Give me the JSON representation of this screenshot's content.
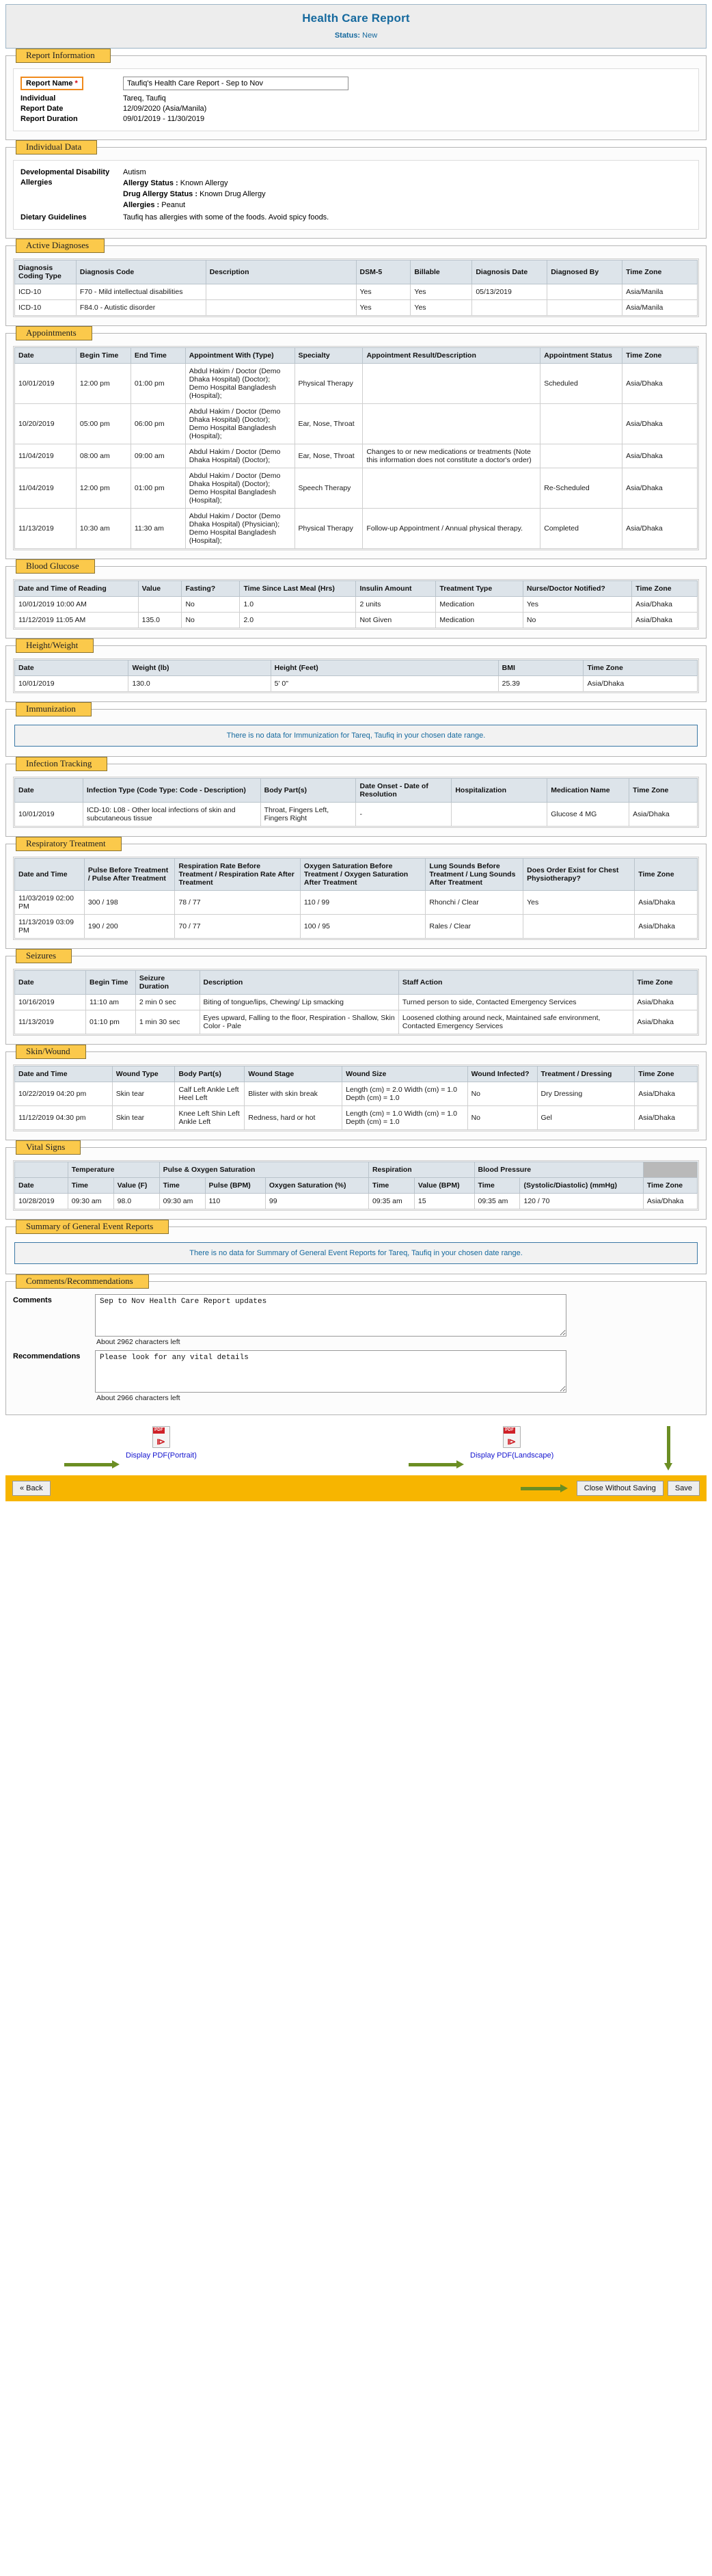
{
  "header": {
    "title": "Health Care Report",
    "status_label": "Status:",
    "status_value": "New"
  },
  "report_information": {
    "legend": "Report Information",
    "report_name_label": "Report Name",
    "required_mark": "*",
    "report_name_value": "Taufiq's Health Care Report - Sep to Nov",
    "individual_label": "Individual",
    "individual_value": "Tareq, Taufiq",
    "report_date_label": "Report Date",
    "report_date_value": "12/09/2020  (Asia/Manila)",
    "report_duration_label": "Report Duration",
    "report_duration_value": "09/01/2019 - 11/30/2019"
  },
  "individual_data": {
    "legend": "Individual Data",
    "dd_label": "Developmental Disability",
    "dd_value": "Autism",
    "allergies_label": "Allergies",
    "allergy_status_label": "Allergy Status :",
    "allergy_status_value": "Known Allergy",
    "drug_allergy_status_label": "Drug Allergy Status :",
    "drug_allergy_status_value": "Known Drug Allergy",
    "allergies_list_label": "Allergies :",
    "allergies_list_value": "Peanut",
    "dietary_label": "Dietary Guidelines",
    "dietary_value": "Taufiq has allergies with some of the foods. Avoid spicy foods."
  },
  "active_diagnoses": {
    "legend": "Active Diagnoses",
    "columns": [
      "Diagnosis Coding Type",
      "Diagnosis Code",
      "Description",
      "DSM-5",
      "Billable",
      "Diagnosis Date",
      "Diagnosed By",
      "Time Zone"
    ],
    "rows": [
      [
        "ICD-10",
        "F70 - Mild intellectual disabilities",
        "",
        "Yes",
        "Yes",
        "05/13/2019",
        "",
        "Asia/Manila"
      ],
      [
        "ICD-10",
        "F84.0 - Autistic disorder",
        "",
        "Yes",
        "Yes",
        "",
        "",
        "Asia/Manila"
      ]
    ]
  },
  "appointments": {
    "legend": "Appointments",
    "columns": [
      "Date",
      "Begin Time",
      "End Time",
      "Appointment With (Type)",
      "Specialty",
      "Appointment Result/Description",
      "Appointment Status",
      "Time Zone"
    ],
    "rows": [
      [
        "10/01/2019",
        "12:00 pm",
        "01:00 pm",
        "Abdul Hakim / Doctor (Demo Dhaka Hospital) (Doctor); Demo Hospital Bangladesh (Hospital);",
        "Physical Therapy",
        "",
        "Scheduled",
        "Asia/Dhaka"
      ],
      [
        "10/20/2019",
        "05:00 pm",
        "06:00 pm",
        "Abdul Hakim / Doctor (Demo Dhaka Hospital) (Doctor); Demo Hospital Bangladesh (Hospital);",
        "Ear, Nose, Throat",
        "",
        "",
        "Asia/Dhaka"
      ],
      [
        "11/04/2019",
        "08:00 am",
        "09:00 am",
        "Abdul Hakim / Doctor (Demo Dhaka Hospital) (Doctor);",
        "Ear, Nose, Throat",
        "Changes to or new medications or treatments (Note this information does not constitute a doctor's order)",
        "",
        "Asia/Dhaka"
      ],
      [
        "11/04/2019",
        "12:00 pm",
        "01:00 pm",
        "Abdul Hakim / Doctor (Demo Dhaka Hospital) (Doctor); Demo Hospital Bangladesh (Hospital);",
        "Speech Therapy",
        "",
        "Re-Scheduled",
        "Asia/Dhaka"
      ],
      [
        "11/13/2019",
        "10:30 am",
        "11:30 am",
        "Abdul Hakim / Doctor (Demo Dhaka Hospital) (Physician); Demo Hospital Bangladesh (Hospital);",
        "Physical Therapy",
        "Follow-up Appointment / Annual physical therapy.",
        "Completed",
        "Asia/Dhaka"
      ]
    ]
  },
  "blood_glucose": {
    "legend": "Blood Glucose",
    "columns": [
      "Date and Time of Reading",
      "Value",
      "Fasting?",
      "Time Since Last Meal (Hrs)",
      "Insulin Amount",
      "Treatment Type",
      "Nurse/Doctor Notified?",
      "Time Zone"
    ],
    "rows": [
      [
        "10/01/2019 10:00 AM",
        "",
        "No",
        "1.0",
        "2 units",
        "Medication",
        "Yes",
        "Asia/Dhaka"
      ],
      [
        "11/12/2019 11:05 AM",
        "135.0",
        "No",
        "2.0",
        "Not Given",
        "Medication",
        "No",
        "Asia/Dhaka"
      ]
    ]
  },
  "height_weight": {
    "legend": "Height/Weight",
    "columns": [
      "Date",
      "Weight (lb)",
      "Height (Feet)",
      "BMI",
      "Time Zone"
    ],
    "rows": [
      [
        "10/01/2019",
        "130.0",
        "5' 0\"",
        "25.39",
        "Asia/Dhaka"
      ]
    ]
  },
  "immunization": {
    "legend": "Immunization",
    "empty_message": "There is no data for Immunization for Tareq, Taufiq in your chosen date range."
  },
  "infection_tracking": {
    "legend": "Infection Tracking",
    "columns": [
      "Date",
      "Infection Type (Code Type: Code - Description)",
      "Body Part(s)",
      "Date Onset - Date of Resolution",
      "Hospitalization",
      "Medication Name",
      "Time Zone"
    ],
    "rows": [
      [
        "10/01/2019",
        "ICD-10: L08 - Other local infections of skin and subcutaneous tissue",
        "Throat, Fingers Left, Fingers Right",
        "-",
        "",
        "Glucose 4 MG",
        "Asia/Dhaka"
      ]
    ]
  },
  "respiratory_treatment": {
    "legend": "Respiratory Treatment",
    "columns": [
      "Date and Time",
      "Pulse Before Treatment / Pulse After Treatment",
      "Respiration Rate Before Treatment / Respiration Rate After Treatment",
      "Oxygen Saturation Before Treatment / Oxygen Saturation After Treatment",
      "Lung Sounds Before Treatment / Lung Sounds After Treatment",
      "Does Order Exist for Chest Physiotherapy?",
      "Time Zone"
    ],
    "rows": [
      [
        "11/03/2019 02:00 PM",
        "300 / 198",
        "78 / 77",
        "110 / 99",
        "Rhonchi / Clear",
        "Yes",
        "Asia/Dhaka"
      ],
      [
        "11/13/2019 03:09 PM",
        "190 / 200",
        "70 / 77",
        "100 / 95",
        "Rales / Clear",
        "",
        "Asia/Dhaka"
      ]
    ]
  },
  "seizures": {
    "legend": "Seizures",
    "columns": [
      "Date",
      "Begin Time",
      "Seizure Duration",
      "Description",
      "Staff Action",
      "Time Zone"
    ],
    "rows": [
      [
        "10/16/2019",
        "11:10 am",
        "2 min 0 sec",
        "Biting of tongue/lips, Chewing/ Lip smacking",
        "Turned person to side, Contacted Emergency Services",
        "Asia/Dhaka"
      ],
      [
        "11/13/2019",
        "01:10 pm",
        "1 min 30 sec",
        "Eyes upward, Falling to the floor, Respiration - Shallow, Skin Color - Pale",
        "Loosened clothing around neck, Maintained safe environment, Contacted Emergency Services",
        "Asia/Dhaka"
      ]
    ]
  },
  "skin_wound": {
    "legend": "Skin/Wound",
    "columns": [
      "Date and Time",
      "Wound Type",
      "Body Part(s)",
      "Wound Stage",
      "Wound Size",
      "Wound Infected?",
      "Treatment / Dressing",
      "Time Zone"
    ],
    "rows": [
      [
        "10/22/2019 04:20 pm",
        "Skin tear",
        "Calf Left Ankle Left Heel Left",
        "Blister with skin break",
        "Length (cm) = 2.0 Width (cm) = 1.0 Depth (cm) = 1.0",
        "No",
        "Dry Dressing",
        "Asia/Dhaka"
      ],
      [
        "11/12/2019 04:30 pm",
        "Skin tear",
        "Knee Left Shin Left Ankle Left",
        "Redness, hard or hot",
        "Length (cm) = 1.0 Width (cm) = 1.0 Depth (cm) = 1.0",
        "No",
        "Gel",
        "Asia/Dhaka"
      ]
    ]
  },
  "vital_signs": {
    "legend": "Vital Signs",
    "group_headers": [
      "",
      "Temperature",
      "Pulse & Oxygen Saturation",
      "Respiration",
      "Blood Pressure",
      ""
    ],
    "columns": [
      "Date",
      "Time",
      "Value (F)",
      "Time",
      "Pulse (BPM)",
      "Oxygen Saturation (%)",
      "Time",
      "Value (BPM)",
      "Time",
      "(Systolic/Diastolic) (mmHg)",
      "Time Zone"
    ],
    "rows": [
      [
        "10/28/2019",
        "09:30 am",
        "98.0",
        "09:30 am",
        "110",
        "99",
        "09:35 am",
        "15",
        "09:35 am",
        "120 / 70",
        "Asia/Dhaka"
      ]
    ]
  },
  "summary_general_event_reports": {
    "legend": "Summary of General Event Reports",
    "empty_message": "There is no data for Summary of General Event Reports for Tareq, Taufiq in your chosen date range."
  },
  "comments_recommendations": {
    "legend": "Comments/Recommendations",
    "comments_label": "Comments",
    "comments_value": "Sep to Nov Health Care Report updates",
    "comments_chars_left": "About 2962 characters left",
    "recommendations_label": "Recommendations",
    "recommendations_value": "Please look for any vital details",
    "recommendations_chars_left": "About 2966 characters left"
  },
  "pdf_links": {
    "portrait": "Display PDF(Portrait)",
    "landscape": "Display PDF(Landscape)"
  },
  "footer": {
    "back": "« Back",
    "close_without_saving": "Close Without Saving",
    "save": "Save"
  },
  "colors": {
    "accent_blue": "#15699e",
    "legend_yellow": "#fbc94b",
    "footer_yellow": "#f7b500",
    "arrow_green": "#6b8e23",
    "required_red": "#d4000a"
  }
}
